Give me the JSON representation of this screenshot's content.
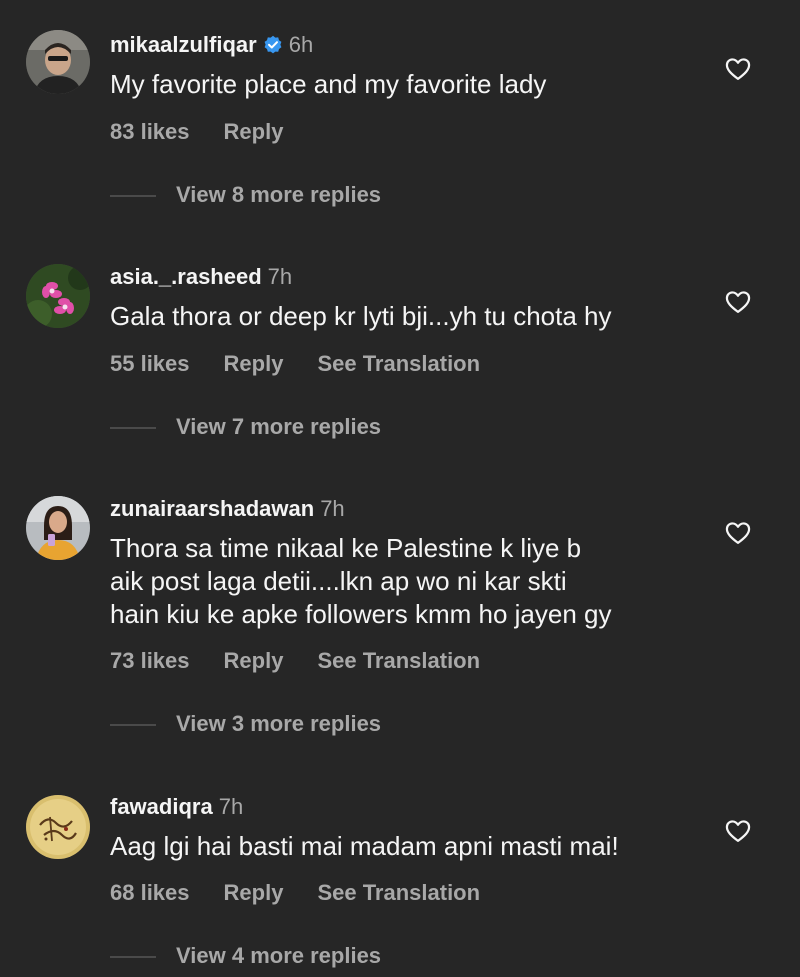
{
  "colors": {
    "background": "#262626",
    "primary_text": "#f5f5f5",
    "secondary_text": "#a8a8a8",
    "verified_blue": "#3897f0"
  },
  "comments": [
    {
      "username": "mikaalzulfiqar",
      "verified": true,
      "time": "6h",
      "text": "My favorite place and my favorite lady",
      "likes": "83 likes",
      "reply": "Reply",
      "translate": "",
      "view_replies": "View 8 more replies",
      "avatar_icon": "profile-photo-man"
    },
    {
      "username": "asia._.rasheed",
      "verified": false,
      "time": "7h",
      "text": "Gala thora or deep kr lyti bji...yh tu chota hy",
      "likes": "55 likes",
      "reply": "Reply",
      "translate": "See Translation",
      "view_replies": "View 7 more replies",
      "avatar_icon": "profile-photo-flower"
    },
    {
      "username": "zunairaarshadawan",
      "verified": false,
      "time": "7h",
      "text": "Thora sa time nikaal ke Palestine k liye b\naik post laga detii....lkn ap wo ni kar skti\nhain kiu ke apke followers kmm ho jayen gy",
      "likes": "73 likes",
      "reply": "Reply",
      "translate": "See Translation",
      "view_replies": "View 3 more replies",
      "avatar_icon": "profile-photo-woman"
    },
    {
      "username": "fawadiqra",
      "verified": false,
      "time": "7h",
      "text": "Aag lgi hai basti mai madam apni masti mai!",
      "likes": "68 likes",
      "reply": "Reply",
      "translate": "See Translation",
      "view_replies": "View 4 more replies",
      "avatar_icon": "profile-photo-calligraphy"
    }
  ]
}
